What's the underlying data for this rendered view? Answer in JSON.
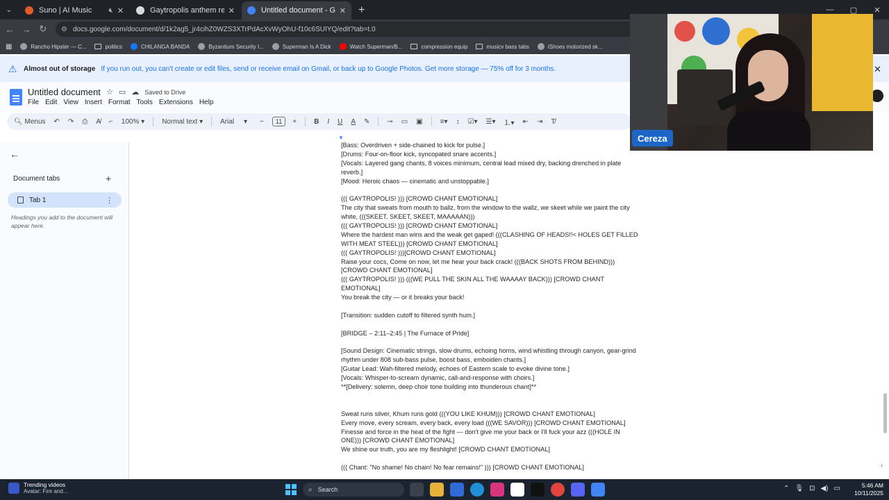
{
  "browser": {
    "tabs": [
      {
        "title": "Suno | AI Music",
        "favicon_color": "#e25b2a",
        "muted_icon": "speaker-muted-icon",
        "active": false
      },
      {
        "title": "Gaytropolis anthem rewrite",
        "favicon_color": "#d9d9d9",
        "active": false
      },
      {
        "title": "Untitled document - Google D",
        "favicon_color": "#4285f4",
        "active": true
      }
    ],
    "new_tab_label": "+",
    "url": "docs.google.com/document/d/1k2ag5_jr4cihZ0WZS3XTrPdAcXvWyOhU-f10c6SUIYQ/edit?tab=t.0",
    "bookmarks": [
      {
        "label": "Rancho Hipster — C...",
        "kind": "site",
        "color": "#9aa0a6"
      },
      {
        "label": "politics",
        "kind": "folder"
      },
      {
        "label": "CHILANGA BANDA",
        "kind": "site",
        "color": "#1877f2"
      },
      {
        "label": "Byzantium Security I...",
        "kind": "site",
        "color": "#9aa0a6"
      },
      {
        "label": "Superman Is A Dick",
        "kind": "site",
        "color": "#9aa0a6"
      },
      {
        "label": "Watch Superman/B...",
        "kind": "site",
        "color": "#ff0000"
      },
      {
        "label": "compression equip",
        "kind": "folder"
      },
      {
        "label": "musicv bass tabs",
        "kind": "folder"
      },
      {
        "label": "iShoes motorized sk...",
        "kind": "site",
        "color": "#9aa0a6"
      }
    ]
  },
  "banner": {
    "title": "Almost out of storage",
    "message": "If you run out, you can't create or edit files, send or receive email on Gmail, or back up to Google Photos. Get more storage — 75% off for 3 months."
  },
  "docs": {
    "title": "Untitled document",
    "saved_status": "Saved to Drive",
    "menu": [
      "File",
      "Edit",
      "View",
      "Insert",
      "Format",
      "Tools",
      "Extensions",
      "Help"
    ],
    "toolbar": {
      "menus_label": "Menus",
      "zoom": "100%",
      "style": "Normal text",
      "font": "Arial",
      "font_size": "11"
    }
  },
  "sidebar": {
    "heading": "Document tabs",
    "tab_name": "Tab 1",
    "hint": "Headings you add to the document will appear here."
  },
  "document": {
    "lines": [
      "[Bass: Overdriven + side-chained to kick for pulse.]",
      "[Drums: Four-on-floor kick, syncopated snare accents.]",
      "[Vocals: Layered gang chants, 8 voices minimum, central lead mixed dry, backing drenched in plate",
      "reverb.]",
      "[Mood: Heroic chaos — cinematic and unstoppable.]",
      "",
      "((( GAYTROPOLIS! ))) [CROWD CHANT EMOTIONAL]",
      "The city that sweats from mouth to ballz, from the window to the wallz, we skeet while we paint the city",
      "white, (((SKEET, SKEET, SKEET, MAAAAAN)))",
      "((( GAYTROPOLIS! ))) [CROWD CHANT EMOTIONAL]",
      "Where the hardest man wins and the weak get gaped! (((CLASHING OF HEADS!!< HOLES GET FILLED",
      "WITH MEAT STEEL))) [CROWD CHANT EMOTIONAL]",
      "((( GAYTROPOLIS! )))[CROWD CHANT EMOTIONAL]",
      "Raise your cocs, Come on now, let me hear your back crack! (((BACK SHOTS FROM BEHIND)))",
      "[CROWD CHANT EMOTIONAL]",
      "((( GAYTROPOLIS! ))) (((WE PULL THE SKIN ALL THE WAAAAY BACK))) [CROWD CHANT",
      "EMOTIONAL]",
      "You break the city — or it breaks your back!",
      "",
      "[Transition: sudden cutoff to filtered synth hum.]",
      "",
      "[BRIDGE – 2:11–2:45 | The Furnace of Pride]",
      "",
      "[Sound Design: Cinematic strings, slow drums, echoing horns, wind whistling through canyon, gear-grind",
      "rhythm under 808 sub-bass pulse, boost bass, emboiden chants.]",
      "[Guitar Lead: Wah-filtered melody, echoes of Eastern scale to evoke divine tone.]",
      "[Vocals: Whisper-to-scream dynamic, call-and-response with choirs.]",
      "**[Delivery: solemn, deep choir tone building into thunderous chant]**",
      "",
      "",
      "Sweat runs silver, Khum runs gold (((YOU LIKE KHUM))) [CROWD CHANT EMOTIONAL]",
      "Every move, every scream, every back, every load (((WE SAVOR))) [CROWD CHANT EMOTIONAL]",
      "Finesse and force in the heat of the fight — don't give me your back or I'll fuck your azz (((HOLE IN",
      "ONE))) [CROWD CHANT EMOTIONAL]",
      "We shine our truth, you are my fleshlight! [CROWD CHANT EMOTIONAL]",
      "",
      "((( Chant: \"No shame! No chain! No fear remains!\" ))) [CROWD CHANT EMOTIONAL]"
    ]
  },
  "webcam": {
    "name": "Cereza"
  },
  "taskbar": {
    "trend_title": "Trending videos",
    "trend_sub": "Avatar: Fire and...",
    "search_placeholder": "Search",
    "time": "5:46 AM",
    "date": "10/11/2025"
  }
}
